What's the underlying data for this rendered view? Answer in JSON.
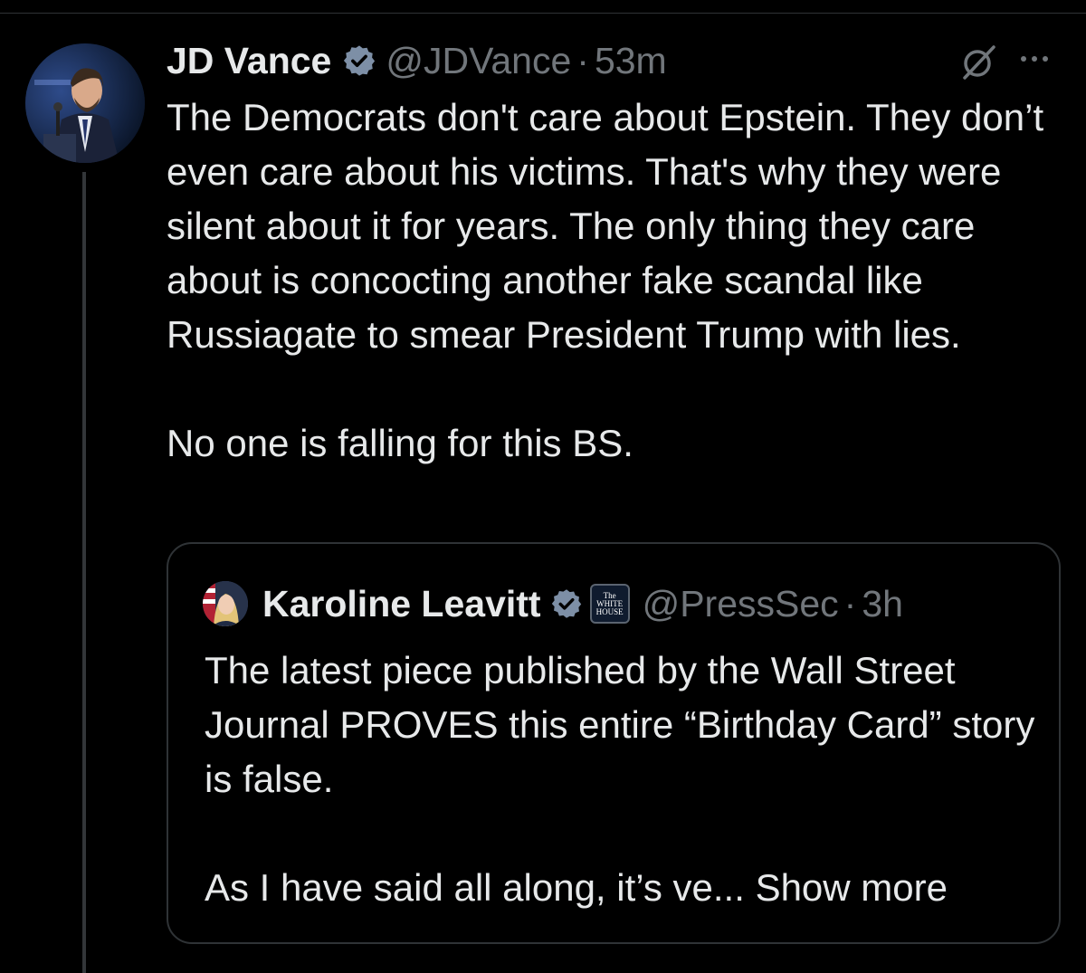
{
  "tweet": {
    "author_name": "JD Vance",
    "author_handle": "@JDVance",
    "separator": "·",
    "time": "53m",
    "paragraph_1": "The Democrats don't care about Epstein. They don’t even care about his victims. That's why they were silent about it for years. The only thing they care about is concocting another fake scandal like Russiagate to smear President Trump with lies.",
    "paragraph_2": "No one is falling for this BS."
  },
  "quote": {
    "author_name": "Karoline Leavitt",
    "author_handle": "@PressSec",
    "separator": "·",
    "time": "3h",
    "affiliate_badge_line1": "The",
    "affiliate_badge_line2": "WHITE",
    "affiliate_badge_line3": "HOUSE",
    "paragraph_1": "The latest piece published by the Wall Street Journal PROVES this entire “Birthday Card” story is false.",
    "paragraph_2_truncated": "As I have said all along, it’s ve... ",
    "show_more_label": "Show more"
  },
  "icons": {
    "verified": "verified-badge-icon",
    "grok": "grok-icon",
    "more": "more-options-icon"
  },
  "colors": {
    "background": "#000000",
    "text_primary": "#e7e9ea",
    "text_secondary": "#71767b",
    "border": "#2f3336",
    "verified_badge": "#7d8fa6"
  }
}
